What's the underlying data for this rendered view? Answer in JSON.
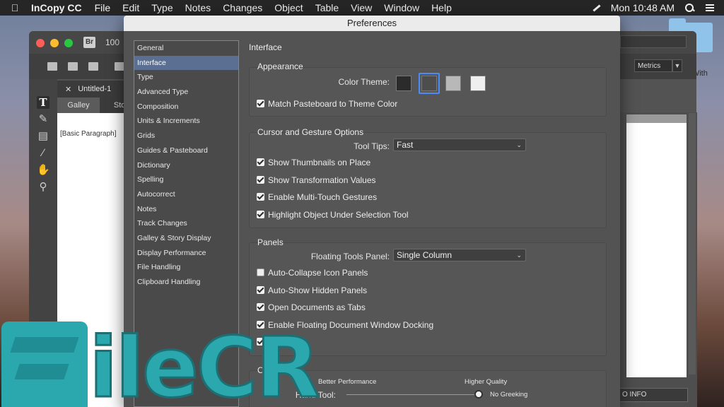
{
  "menubar": {
    "app_name": "InCopy CC",
    "items": [
      "File",
      "Edit",
      "Type",
      "Notes",
      "Changes",
      "Object",
      "Table",
      "View",
      "Window",
      "Help"
    ],
    "clock": "Mon 10:48 AM"
  },
  "desktop": {
    "folder_label": "er With"
  },
  "app_window": {
    "bridge_badge": "Br",
    "zoom": "100",
    "doc_tab": "Untitled-1",
    "view_tabs": [
      "Galley",
      "Stor"
    ],
    "galley_style": "[Basic Paragraph]",
    "metrics": "Metrics",
    "info_label": "O INFO"
  },
  "dialog": {
    "title": "Preferences",
    "categories": [
      "General",
      "Interface",
      "Type",
      "Advanced Type",
      "Composition",
      "Units & Increments",
      "Grids",
      "Guides & Pasteboard",
      "Dictionary",
      "Spelling",
      "Autocorrect",
      "Notes",
      "Track Changes",
      "Galley & Story Display",
      "Display Performance",
      "File Handling",
      "Clipboard Handling"
    ],
    "selected_category": "Interface",
    "pane_title": "Interface",
    "appearance": {
      "title": "Appearance",
      "color_theme_label": "Color Theme:",
      "themes": [
        "#2b2b2b",
        "#4d4d4d",
        "#b8b8b8",
        "#eeeeee"
      ],
      "selected_theme_color": "#4c8bf5",
      "match_pasteboard": {
        "label": "Match Pasteboard to Theme Color",
        "checked": true
      }
    },
    "cursor": {
      "title": "Cursor and Gesture Options",
      "tool_tips_label": "Tool Tips:",
      "tool_tips_value": "Fast",
      "options": [
        {
          "label": "Show Thumbnails on Place",
          "checked": true
        },
        {
          "label": "Show Transformation Values",
          "checked": true
        },
        {
          "label": "Enable Multi-Touch Gestures",
          "checked": true
        },
        {
          "label": "Highlight Object Under Selection Tool",
          "checked": true
        }
      ]
    },
    "panels": {
      "title": "Panels",
      "floating_tools_label": "Floating Tools Panel:",
      "floating_tools_value": "Single Column",
      "options": [
        {
          "label": "Auto-Collapse Icon Panels",
          "checked": false
        },
        {
          "label": "Auto-Show Hidden Panels",
          "checked": true
        },
        {
          "label": "Open Documents as Tabs",
          "checked": true
        },
        {
          "label": "Enable Floating Document Window Docking",
          "checked": true
        },
        {
          "label": "e Ta",
          "checked": true
        }
      ]
    },
    "options": {
      "title_partial": "Op",
      "better_performance": "Better Performance",
      "higher_quality": "Higher Quality",
      "hand_tool_label": "Hand Tool:",
      "hand_tool_value": "No Greeking",
      "hand_tool_level": 1.0
    }
  },
  "watermark": {
    "text": "ileCR"
  }
}
